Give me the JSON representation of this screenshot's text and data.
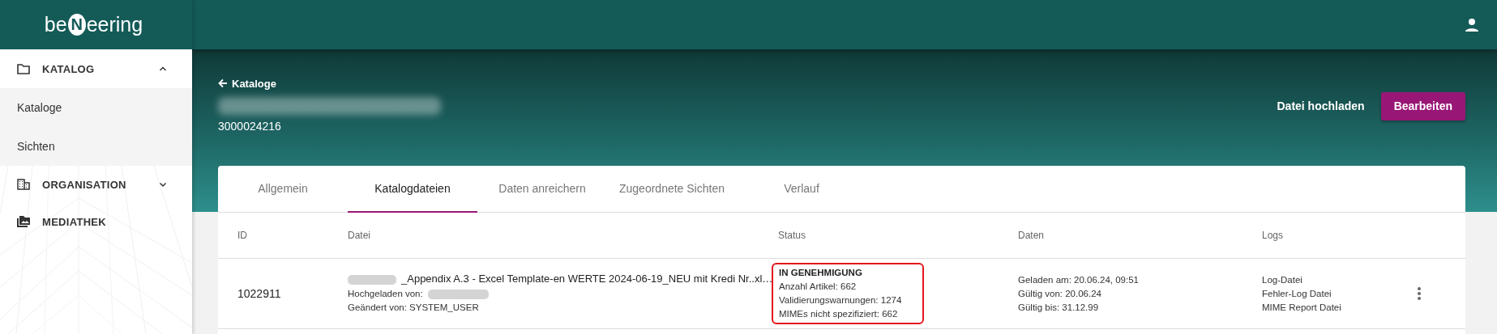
{
  "logo": {
    "prefix": "be",
    "mark": "N",
    "suffix": "eering"
  },
  "sidebar": {
    "items": [
      {
        "label": "KATALOG",
        "expanded": true,
        "children": [
          {
            "label": "Kataloge"
          },
          {
            "label": "Sichten"
          }
        ]
      },
      {
        "label": "ORGANISATION",
        "expanded": false
      },
      {
        "label": "MEDIATHEK"
      }
    ]
  },
  "header": {
    "back_link": "Kataloge",
    "title": {
      "redacted": true
    },
    "catalog_id": "3000024216",
    "actions": [
      {
        "label": "Datei hochladen",
        "kind": "text"
      },
      {
        "label": "Bearbeiten",
        "kind": "primary"
      }
    ]
  },
  "tabs": [
    {
      "label": "Allgemein",
      "selected": false
    },
    {
      "label": "Katalogdateien",
      "selected": true
    },
    {
      "label": "Daten anreichern",
      "selected": false
    },
    {
      "label": "Zugeordnete Sichten",
      "selected": false
    },
    {
      "label": "Verlauf",
      "selected": false
    }
  ],
  "table": {
    "columns": [
      "ID",
      "Datei",
      "Status",
      "Daten",
      "Logs"
    ],
    "rows": [
      {
        "id": "1022911",
        "file": {
          "redacted_prefix": true,
          "name": "_Appendix A.3 - Excel Template-en WERTE 2024-06-19_NEU mit Kredi Nr..xl…"
        },
        "uploaded_by": {
          "label": "Hochgeladen von:",
          "redacted": true
        },
        "changed_by": "Geändert von: SYSTEM_USER",
        "status": {
          "title": "IN GENEHMIGUNG",
          "highlighted": true,
          "lines": [
            "Anzahl Artikel: 662",
            "Validierungswarnungen: 1274",
            "MIMEs nicht spezifiziert: 662"
          ]
        },
        "dates": [
          "Geladen am: 20.06.24, 09:51",
          "Gültig von: 20.06.24",
          "Gültig bis: 31.12.99"
        ],
        "logs": [
          "Log-Datei",
          "Fehler-Log Datei",
          "MIME Report Datei"
        ]
      }
    ]
  }
}
